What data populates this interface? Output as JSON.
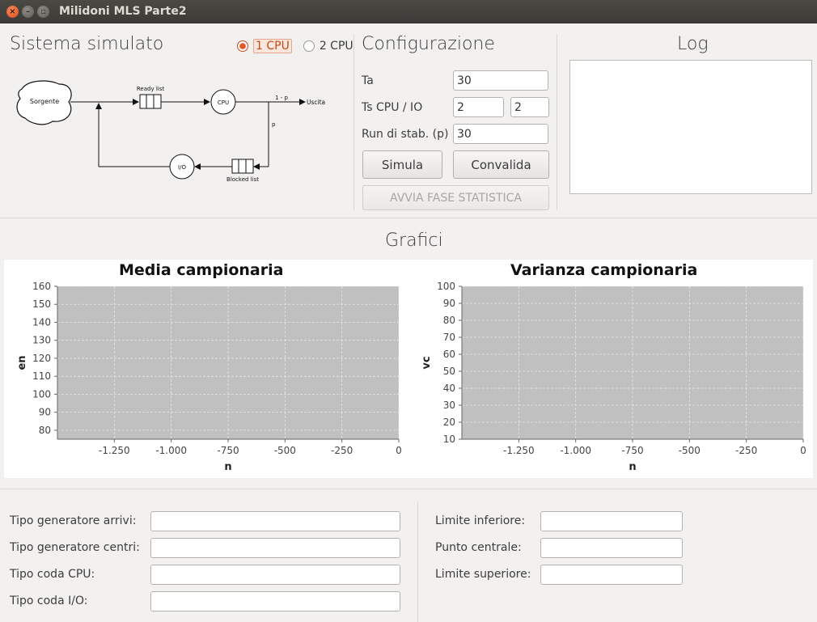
{
  "window": {
    "title": "Milidoni MLS Parte2"
  },
  "system": {
    "title": "Sistema simulato",
    "radio_options": [
      {
        "label": "1 CPU",
        "selected": true
      },
      {
        "label": "2 CPU",
        "selected": false
      }
    ],
    "diagram": {
      "source": "Sorgente",
      "ready_list": "Ready list",
      "cpu": "CPU",
      "exit_prob": "1 - p",
      "exit": "Uscita",
      "loop_prob": "p",
      "io": "I/O",
      "blocked_list": "Blocked list"
    }
  },
  "config": {
    "title": "Configurazione",
    "ta_label": "Ta",
    "ta_value": "30",
    "ts_label": "Ts CPU / IO",
    "ts_cpu_value": "2",
    "ts_io_value": "2",
    "run_label": "Run di stab. (p)",
    "run_value": "30",
    "simula_label": "Simula",
    "convalida_label": "Convalida",
    "avvia_label": "AVVIA FASE STATISTICA"
  },
  "log": {
    "title": "Log",
    "content": ""
  },
  "grafici": {
    "title": "Grafici"
  },
  "chart_data": [
    {
      "type": "line",
      "title": "Media campionaria",
      "xlabel": "n",
      "ylabel": "en",
      "series": [],
      "xlim": [
        -1500,
        0
      ],
      "ylim": [
        75,
        160
      ],
      "xticks": [
        -1250,
        -1000,
        -750,
        -500,
        -250,
        0
      ],
      "xtick_labels": [
        "-1.250",
        "-1.000",
        "-750",
        "-500",
        "-250",
        "0"
      ],
      "yticks": [
        80,
        90,
        100,
        110,
        120,
        130,
        140,
        150,
        160
      ],
      "ytick_labels": [
        "80",
        "90",
        "100",
        "110",
        "120",
        "130",
        "140",
        "150",
        "160"
      ],
      "grid": true
    },
    {
      "type": "line",
      "title": "Varianza campionaria",
      "xlabel": "n",
      "ylabel": "vc",
      "series": [],
      "xlim": [
        -1500,
        0
      ],
      "ylim": [
        10,
        100
      ],
      "xticks": [
        -1250,
        -1000,
        -750,
        -500,
        -250,
        0
      ],
      "xtick_labels": [
        "-1.250",
        "-1.000",
        "-750",
        "-500",
        "-250",
        "0"
      ],
      "yticks": [
        10,
        20,
        30,
        40,
        50,
        60,
        70,
        80,
        90,
        100
      ],
      "ytick_labels": [
        "10",
        "20",
        "30",
        "40",
        "50",
        "60",
        "70",
        "80",
        "90",
        "100"
      ],
      "grid": true
    }
  ],
  "generators": {
    "arrivi_label": "Tipo generatore arrivi:",
    "arrivi_value": "",
    "centri_label": "Tipo generatore centri:",
    "centri_value": "",
    "coda_cpu_label": "Tipo coda CPU:",
    "coda_cpu_value": "",
    "coda_io_label": "Tipo coda I/O:",
    "coda_io_value": ""
  },
  "limits": {
    "inferiore_label": "Limite inferiore:",
    "inferiore_value": "",
    "centrale_label": "Punto centrale:",
    "centrale_value": "",
    "superiore_label": "Limite superiore:",
    "superiore_value": ""
  }
}
